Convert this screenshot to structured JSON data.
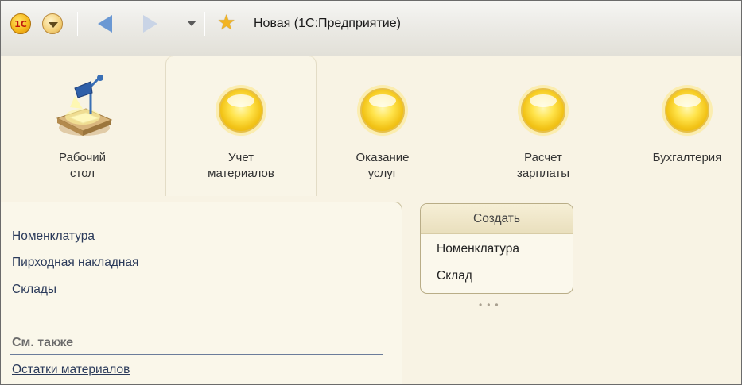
{
  "window": {
    "title": "Новая  (1С:Предприятие)",
    "logo_text": "1С"
  },
  "sections": [
    {
      "label": "Рабочий\nстол",
      "icon": "desk-lamp-icon",
      "active": false
    },
    {
      "label": "Учет\nматериалов",
      "icon": "orb-icon",
      "active": true
    },
    {
      "label": "Оказание\nуслуг",
      "icon": "orb-icon",
      "active": false
    },
    {
      "label": "Расчет\nзарплаты",
      "icon": "orb-icon",
      "active": false
    },
    {
      "label": "Бухгалтерия",
      "icon": "orb-icon",
      "active": false
    }
  ],
  "navigation": {
    "items": [
      "Номенклатура",
      "Пирходная накладная",
      "Склады"
    ],
    "see_also_title": "См. также",
    "see_also_items": [
      "Остатки материалов"
    ]
  },
  "create_panel": {
    "title": "Создать",
    "items": [
      "Номенклатура",
      "Склад"
    ]
  },
  "colors": {
    "background": "#f8f3e4",
    "accent_orb": "#f2c317",
    "link": "#2a3a5a"
  }
}
